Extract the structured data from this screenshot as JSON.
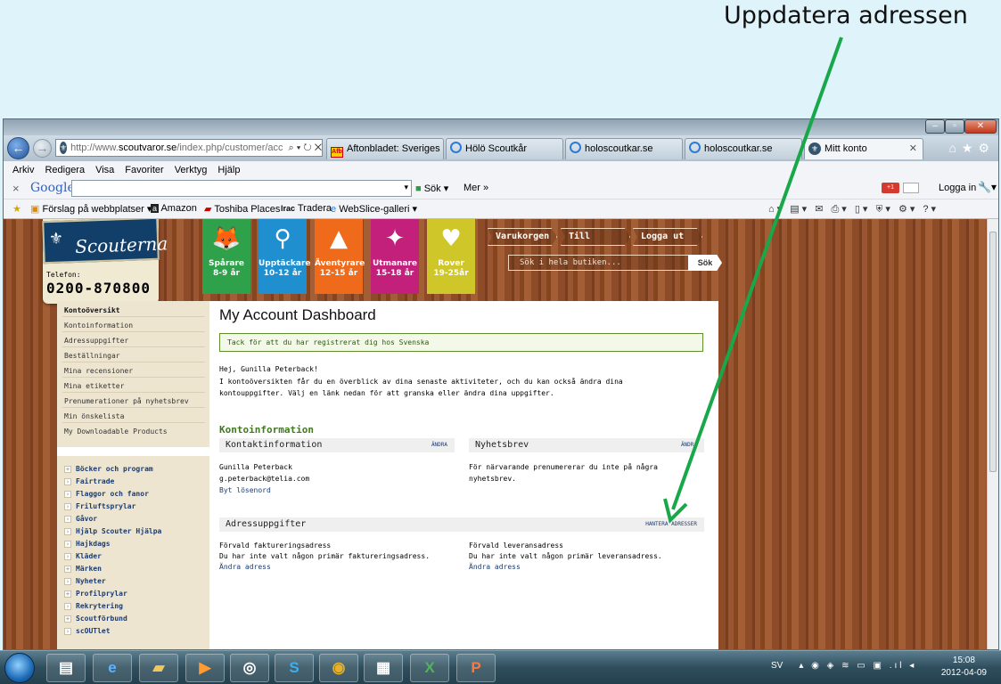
{
  "annotation": {
    "text": "Uppdatera adressen",
    "color": "#18a84a"
  },
  "browser": {
    "address": {
      "prefix": "http://www.",
      "domain": "scoutvaror.se",
      "rest": "/index.php/customer/acc"
    },
    "tabs": [
      {
        "label": "Aftonbladet: Sveriges n..."
      },
      {
        "label": "Hölö Scoutkår"
      },
      {
        "label": "holoscoutkar.se"
      },
      {
        "label": "holoscoutkar.se"
      },
      {
        "label": "Mitt konto",
        "active": true
      }
    ],
    "menu": [
      "Arkiv",
      "Redigera",
      "Visa",
      "Favoriter",
      "Verktyg",
      "Hjälp"
    ],
    "google": {
      "logo": "Google",
      "search": "Sök",
      "more": "Mer »",
      "login": "Logga in",
      "x": "×"
    },
    "favorites": [
      "Förslag på webbplatser ▾",
      "Amazon",
      "Toshiba Places",
      "Tradera",
      "WebSlice-galleri ▾"
    ]
  },
  "site": {
    "logo": {
      "name": "Scouterna",
      "phone_label": "Telefon:",
      "phone": "0200-870800"
    },
    "ages": [
      {
        "name": "Spårare",
        "ages": "8-9 år",
        "color": "#2fa14a",
        "icon": "fox-icon"
      },
      {
        "name": "Upptäckare",
        "ages": "10-12 år",
        "color": "#1f8fd0",
        "icon": "binoculars-icon"
      },
      {
        "name": "Äventyrare",
        "ages": "12-15 år",
        "color": "#f06a1c",
        "icon": "mountain-icon"
      },
      {
        "name": "Utmanare",
        "ages": "15-18 år",
        "color": "#c3207c",
        "icon": "torch-icon"
      },
      {
        "name": "Rover",
        "ages": "19-25år",
        "color": "#cfc72a",
        "icon": "heart-icon"
      }
    ],
    "top_links": [
      "Varukorgen",
      "Till kassen",
      "Logga ut"
    ],
    "search": {
      "placeholder": "Sök i hela butiken...",
      "button": "Sök"
    }
  },
  "account_nav": [
    "Kontoöversikt",
    "Kontoinformation",
    "Adressuppgifter",
    "Beställningar",
    "Mina recensioner",
    "Mina etiketter",
    "Prenumerationer på nyhetsbrev",
    "Min önskelista",
    "My Downloadable Products"
  ],
  "categories": [
    {
      "label": "Böcker och program",
      "mark": "+"
    },
    {
      "label": "Fairtrade",
      "mark": "›"
    },
    {
      "label": "Flaggor och fanor",
      "mark": "›"
    },
    {
      "label": "Friluftsprylar",
      "mark": "›"
    },
    {
      "label": "Gåvor",
      "mark": "›"
    },
    {
      "label": "Hjälp Scouter Hjälpa",
      "mark": "›"
    },
    {
      "label": "Hajkdags",
      "mark": "›"
    },
    {
      "label": "Kläder",
      "mark": "›"
    },
    {
      "label": "Märken",
      "mark": "+"
    },
    {
      "label": "Nyheter",
      "mark": "›"
    },
    {
      "label": "Profilprylar",
      "mark": "+"
    },
    {
      "label": "Rekrytering",
      "mark": "›"
    },
    {
      "label": "Scoutförbund",
      "mark": "+"
    },
    {
      "label": "scOUTlet",
      "mark": "›"
    }
  ],
  "dashboard": {
    "title": "My Account Dashboard",
    "success": "Tack för att du har registrerat dig hos Svenska",
    "greeting": "Hej, Gunilla Peterback!",
    "intro1": "I kontoöversikten får du en överblick av dina senaste aktiviteter, och du kan också ändra dina",
    "intro2": "kontouppgifter. Välj en länk nedan för att granska eller ändra dina uppgifter.",
    "section": "Kontoinformation",
    "contact": {
      "title": "Kontaktinformation",
      "edit": "ÄNDRA",
      "name": "Gunilla Peterback",
      "email": "g.peterback@telia.com",
      "change_pw": "Byt lösenord"
    },
    "newsletter": {
      "title": "Nyhetsbrev",
      "edit": "ÄNDRA",
      "text1": "För närvarande prenumererar du inte på några",
      "text2": "nyhetsbrev."
    },
    "address": {
      "title": "Adressuppgifter",
      "manage": "HANTERA ADRESSER",
      "billing": {
        "title": "Förvald faktureringsadress",
        "text": "Du har inte valt någon primär faktureringsadress.",
        "link": "Ändra adress"
      },
      "shipping": {
        "title": "Förvald leveransadress",
        "text": "Du har inte valt någon primär leveransadress.",
        "link": "Ändra adress"
      }
    }
  },
  "taskbar": {
    "lang": "SV",
    "time": "15:08",
    "date": "2012-04-09"
  }
}
